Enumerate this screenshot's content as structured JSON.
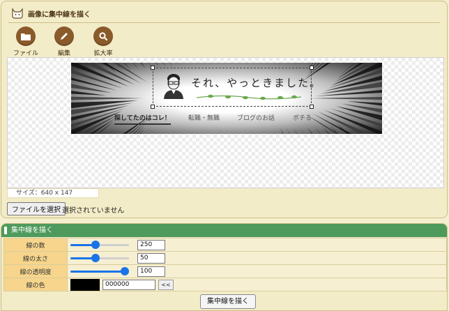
{
  "header": {
    "title": "画像に集中線を描く"
  },
  "toolbar": [
    {
      "label": "ファイル",
      "icon": "folder-icon"
    },
    {
      "label": "編集",
      "icon": "pencil-icon"
    },
    {
      "label": "拡大率",
      "icon": "magnifier-icon"
    }
  ],
  "preview": {
    "banner_text": "それ、やっときました。",
    "nav": [
      "探してたのはコレ！",
      "転職・無職",
      "ブログのお話",
      "ポチる"
    ],
    "size_label": "サイズ：640 x 147"
  },
  "file": {
    "button_label": "ファイルを選択",
    "status": "選択されていません"
  },
  "panel": {
    "title": "集中線を描く",
    "params": [
      {
        "label": "線の数",
        "value": "250",
        "fraction": 0.42
      },
      {
        "label": "線の太さ",
        "value": "50",
        "fraction": 0.42
      },
      {
        "label": "線の透明度",
        "value": "100",
        "fraction": 1.0
      }
    ],
    "color": {
      "label": "線の色",
      "value": "000000",
      "swatch": "#000000",
      "button": "<<"
    },
    "submit_label": "集中線を描く"
  },
  "colors": {
    "accent": "#4e9a5c",
    "tool_icon": "#8a5a2a",
    "slider": "#1a73e8",
    "label_cell": "#f7d58c"
  }
}
